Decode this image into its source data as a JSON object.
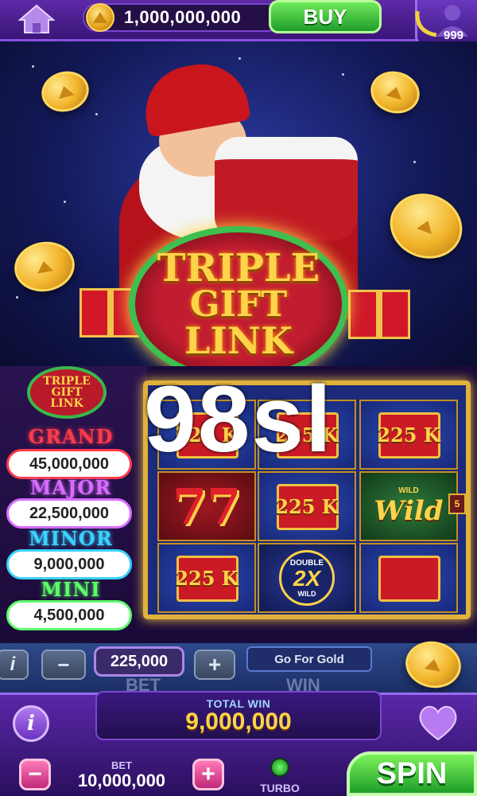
{
  "header": {
    "coin_balance": "1,000,000,000",
    "buy_label": "BUY",
    "level_badge": "999"
  },
  "banner": {
    "logo_lines": [
      "TRIPLE",
      "GIFT",
      "LINK"
    ]
  },
  "jackpots": [
    {
      "name": "GRAND",
      "value": "45,000,000",
      "color": "#ff3a4a"
    },
    {
      "name": "MAJOR",
      "value": "22,500,000",
      "color": "#d86cff"
    },
    {
      "name": "MINOR",
      "value": "9,000,000",
      "color": "#3ad2ff"
    },
    {
      "name": "MINI",
      "value": "4,500,000",
      "color": "#5cff6a"
    }
  ],
  "jackpot_logo_lines": [
    "TRIPLE",
    "GIFT",
    "LINK"
  ],
  "reels": {
    "gift_value": "225 K",
    "wild_label": "Wild",
    "wild_small": "WILD",
    "double_label": "DOUBLE",
    "double_value": "2X",
    "seven": "77",
    "side_badge": "5"
  },
  "watermark": "98sl",
  "bet_row": {
    "minus_icon": "−",
    "plus_icon": "+",
    "bet_amount": "225,000",
    "go_for_gold": "Go For Gold",
    "faded_bet": "BET",
    "faded_win": "WIN",
    "faded_i": "i"
  },
  "bottom": {
    "total_win_label": "TOTAL WIN",
    "total_win_value": "9,000,000",
    "bet_label": "BET",
    "bet_value": "10,000,000",
    "minus": "−",
    "plus": "+",
    "turbo_label": "TURBO",
    "spin_label": "SPIN",
    "info_label": "i"
  }
}
